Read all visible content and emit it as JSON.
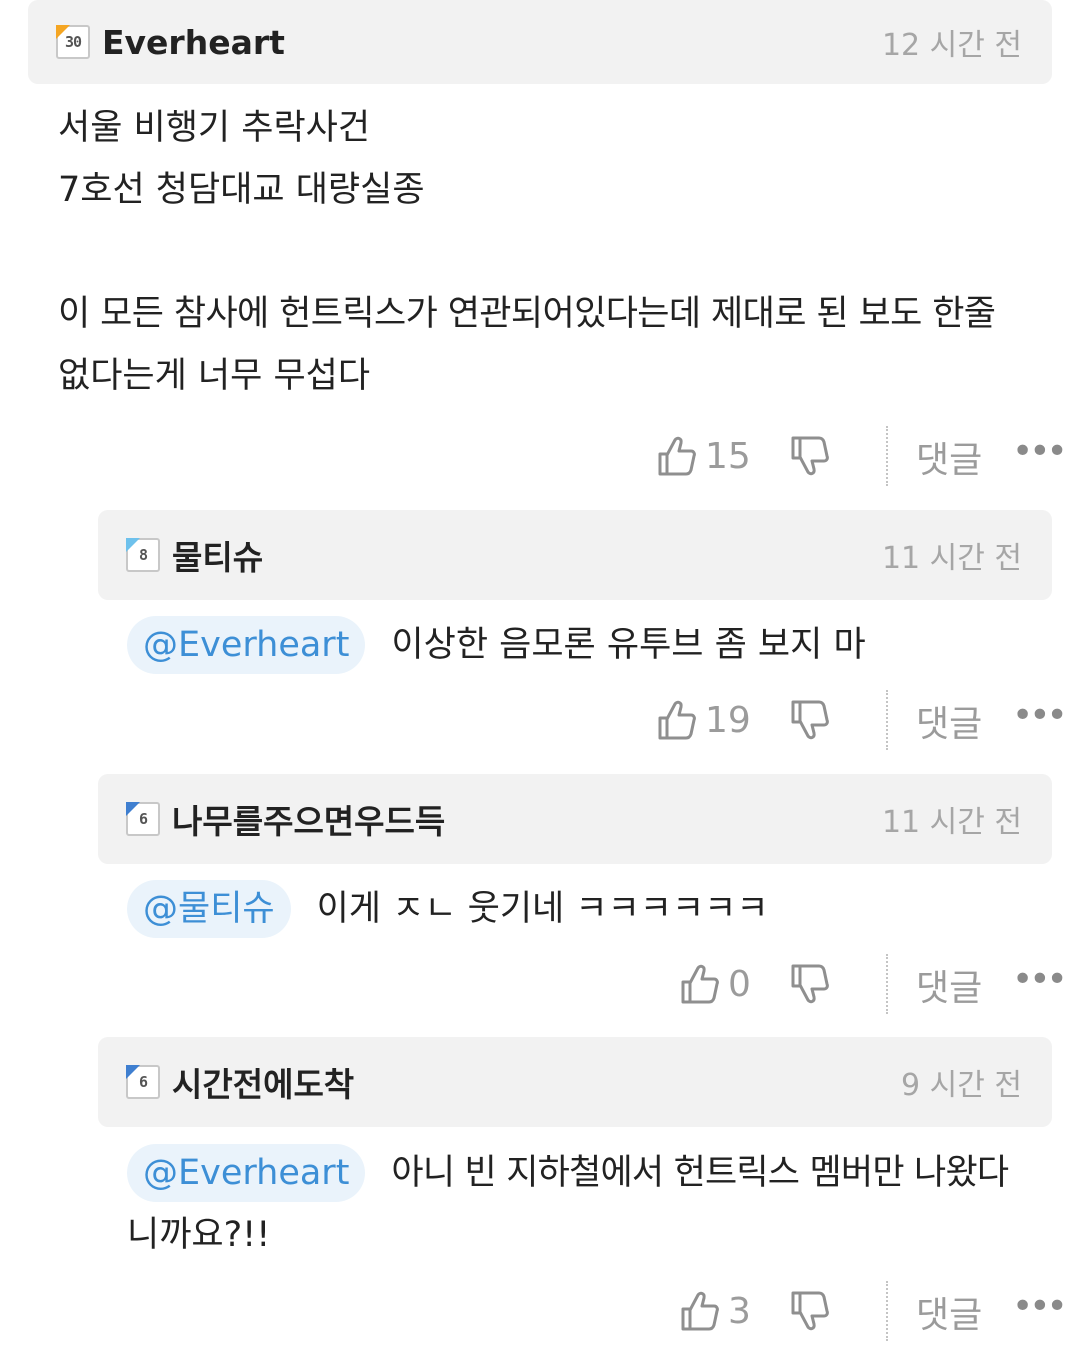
{
  "comments": [
    {
      "level": "30",
      "username": "Everheart",
      "time": "12 시간 전",
      "lines": [
        "서울 비행기 추락사건",
        "7호선 청담대교 대량실종",
        "이 모든 참사에 헌트릭스가 연관되어있다는데 제대로 된 보도 한줄",
        "없다는게 너무 무섭다"
      ],
      "likes": "15",
      "reply_label": "댓글",
      "more": "•••"
    },
    {
      "level": "8",
      "username": "물티슈",
      "time": "11 시간 전",
      "mention": "@Everheart",
      "text": "이상한 음모론 유투브 좀 보지 마",
      "likes": "19",
      "reply_label": "댓글",
      "more": "•••"
    },
    {
      "level": "6",
      "username": "나무를주으면우드득",
      "time": "11 시간 전",
      "mention": "@물티슈",
      "text": "이게 ㅈㄴ 웃기네 ㅋㅋㅋㅋㅋㅋ",
      "likes": "0",
      "reply_label": "댓글",
      "more": "•••"
    },
    {
      "level": "6",
      "username": "시간전에도착",
      "time": "9 시간 전",
      "mention": "@Everheart",
      "text": "아니 빈 지하철에서 헌트릭스 멤버만 나왔다",
      "text2": "니까요?!!",
      "likes": "3",
      "reply_label": "댓글",
      "more": "•••"
    }
  ],
  "icons": {
    "like": "thumbs-up-icon",
    "dislike": "thumbs-down-icon",
    "more": "more-dots-icon"
  },
  "colors": {
    "header_bg": "#f2f2f2",
    "mention_bg": "#eaf3fb",
    "mention_text": "#3d8fd6",
    "muted": "#9b9b9b"
  }
}
